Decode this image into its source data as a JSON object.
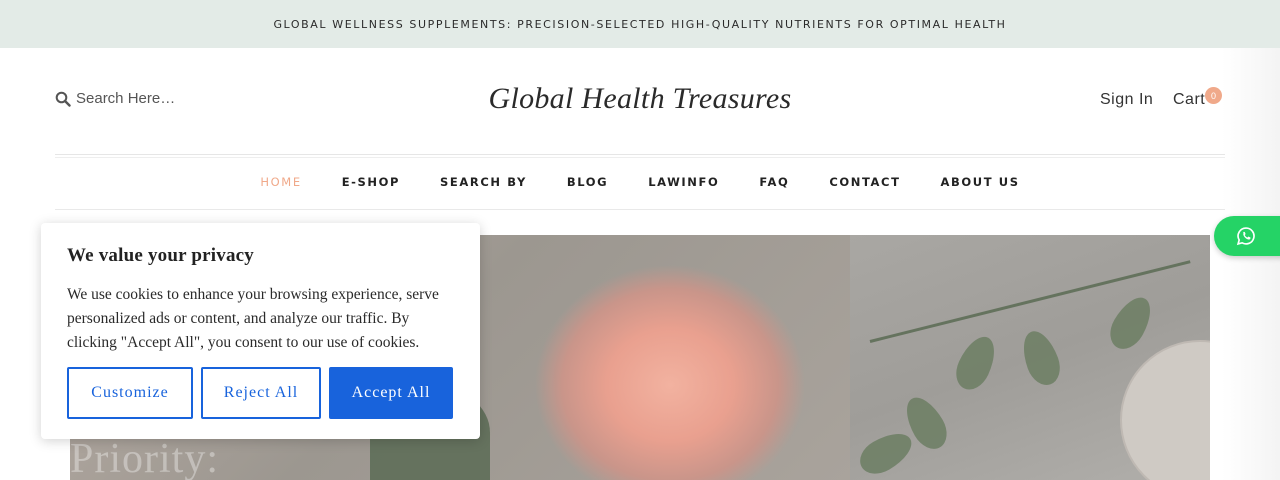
{
  "announcement": {
    "text": "GLOBAL WELLNESS SUPPLEMENTS: PRECISION-SELECTED HIGH-QUALITY NUTRIENTS FOR OPTIMAL HEALTH"
  },
  "header": {
    "search": {
      "placeholder": "Search Here…",
      "icon": "search-icon"
    },
    "logo": "Global Health Treasures",
    "signin_label": "Sign In",
    "cart_label": "Cart",
    "cart_count": "0"
  },
  "nav": {
    "items": [
      {
        "label": "HOME",
        "active": true
      },
      {
        "label": "E-SHOP"
      },
      {
        "label": "SEARCH BY"
      },
      {
        "label": "BLOG"
      },
      {
        "label": "LAWINFO"
      },
      {
        "label": "FAQ"
      },
      {
        "label": "CONTACT"
      },
      {
        "label": "ABOUT US"
      }
    ]
  },
  "hero": {
    "overlay_text": "Priority:"
  },
  "cookie_banner": {
    "title": "We value your privacy",
    "body": "We use cookies to enhance your browsing experience, serve personalized ads or content, and analyze our traffic. By clicking \"Accept All\", you consent to our use of cookies.",
    "customize_label": "Customize",
    "reject_label": "Reject All",
    "accept_label": "Accept All"
  },
  "floating": {
    "whatsapp_icon": "whatsapp-icon"
  },
  "colors": {
    "announcement_bg": "#e3ebe7",
    "accent": "#f0a98a",
    "cookie_primary": "#1863dc",
    "whatsapp": "#25d366"
  }
}
